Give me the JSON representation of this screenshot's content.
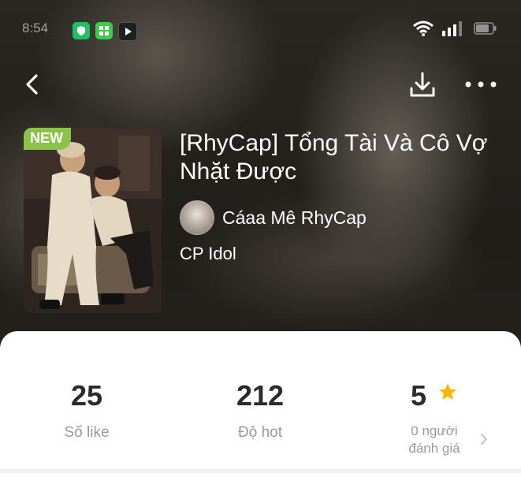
{
  "status_bar": {
    "time": "8:54",
    "apps": [
      {
        "icon": "shield-app-icon",
        "color": "#21c063"
      },
      {
        "icon": "grid-app-icon",
        "color": "#3ecb4f"
      },
      {
        "icon": "play-app-icon",
        "color": "#1f1f1f"
      }
    ]
  },
  "header": {
    "back_icon": "chevron-left-icon",
    "download_icon": "download-icon",
    "more_icon": "more-horizontal-icon"
  },
  "story": {
    "badge": "NEW",
    "title": "[RhyCap] Tổng Tài Và Cô Vợ Nhặt Được",
    "author": "Cáaa Mê RhyCap",
    "category": "CP Idol"
  },
  "stats": {
    "likes": {
      "value": "25",
      "label": "Số like"
    },
    "hot": {
      "value": "212",
      "label": "Độ hot"
    },
    "rating": {
      "value": "5",
      "label_line1": "0 người",
      "label_line2": "đánh giá",
      "star_color": "#f5b800"
    }
  },
  "colors": {
    "badge": "#8bc34a",
    "card": "#ffffff"
  }
}
